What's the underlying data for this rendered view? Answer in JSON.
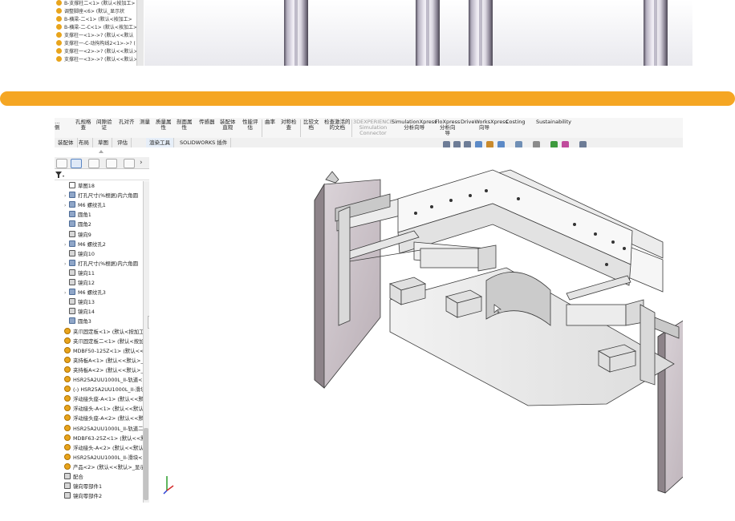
{
  "top_tree": {
    "items": [
      "B-支撑柱二<1> (默认<按加工>",
      "调整脚座<6> (默认_显示状",
      "B-横梁-二<1> (默认<按加工>",
      "B-横梁-二-C<1> (默认<按加工>",
      "支撑柱一<1>->? (默认<<默认",
      "支撑柱一-C-动拘构线2<1>->? (",
      "支撑柱一<2>->? (默认<<默认>",
      "支撑柱一<3>->? (默认<<默认>"
    ]
  },
  "ribbon": {
    "items": [
      {
        "label": "...\n侧"
      },
      {
        "label": "孔规格\n查"
      },
      {
        "label": "间隙验\n证"
      },
      {
        "label": "孔对齐"
      },
      {
        "label": "测量"
      },
      {
        "label": "质量属\n性"
      },
      {
        "label": "剖面属\n性"
      },
      {
        "label": "传感器"
      },
      {
        "label": "装配体\n直观"
      },
      {
        "label": "性能评\n估"
      },
      {
        "label": "曲率"
      },
      {
        "label": "对称检\n查"
      },
      {
        "label": "比较文\n档"
      },
      {
        "label": "检查激活的\n的文档"
      },
      {
        "label": "3DEXPERIENCE\nSimulation\nConnector"
      },
      {
        "label": "SimulationXpress\n分析向导"
      },
      {
        "label": "FloXpress\n分析向\n导"
      },
      {
        "label": "DriveWorksXpress\n向导"
      },
      {
        "label": "Costing"
      },
      {
        "label": "Sustainability"
      }
    ]
  },
  "tabs": [
    "装配体",
    "布局",
    "草图",
    "评估",
    "渲染工具",
    "SOLIDWORKS 插件"
  ],
  "feature_tree": {
    "items": [
      {
        "label": "草图18",
        "icon": "sketch-icon",
        "indent": 1,
        "expand": false
      },
      {
        "label": "打孔尺寸(%根据)内六角圆",
        "icon": "hole-wizard-icon",
        "indent": 1,
        "expand": true
      },
      {
        "label": "M6 螺纹孔1",
        "icon": "hole-wizard-icon",
        "indent": 1,
        "expand": true
      },
      {
        "label": "圆角1",
        "icon": "fillet-icon",
        "indent": 1,
        "expand": false
      },
      {
        "label": "圆角2",
        "icon": "fillet-icon",
        "indent": 1,
        "expand": false
      },
      {
        "label": "镜向9",
        "icon": "mirror-icon",
        "indent": 1,
        "expand": false
      },
      {
        "label": "M6 螺纹孔2",
        "icon": "hole-wizard-icon",
        "indent": 1,
        "expand": true
      },
      {
        "label": "镜向10",
        "icon": "mirror-icon",
        "indent": 1,
        "expand": false
      },
      {
        "label": "打孔尺寸(%根据)内六角圆",
        "icon": "hole-wizard-icon",
        "indent": 1,
        "expand": true
      },
      {
        "label": "镜向11",
        "icon": "mirror-icon",
        "indent": 1,
        "expand": false
      },
      {
        "label": "镜向12",
        "icon": "mirror-icon",
        "indent": 1,
        "expand": false
      },
      {
        "label": "M6 螺纹孔3",
        "icon": "hole-wizard-icon",
        "indent": 1,
        "expand": true
      },
      {
        "label": "镜向13",
        "icon": "mirror-icon",
        "indent": 1,
        "expand": false
      },
      {
        "label": "镜向14",
        "icon": "mirror-icon",
        "indent": 1,
        "expand": false
      },
      {
        "label": "圆角3",
        "icon": "fillet-icon",
        "indent": 1,
        "expand": false
      },
      {
        "label": "夹爪固定板<1> (默认<按加工",
        "icon": "part-icon",
        "indent": 0,
        "expand": false
      },
      {
        "label": "夹爪固定板二<1> (默认<按加",
        "icon": "part-icon",
        "indent": 0,
        "expand": false
      },
      {
        "label": "MDBF50-125Z<1> (默认<<默",
        "icon": "part-icon",
        "indent": 0,
        "expand": false
      },
      {
        "label": "夹持板A<1> (默认<<默认>_",
        "icon": "part-icon",
        "indent": 0,
        "expand": false
      },
      {
        "label": "夹持板A<2> (默认<<默认>_",
        "icon": "part-icon",
        "indent": 0,
        "expand": false
      },
      {
        "label": "HSR25A2UU1000L_II-轨道<1",
        "icon": "part-icon",
        "indent": 0,
        "expand": false
      },
      {
        "label": "(-) HSR25A2UU1000L_II-滑块",
        "icon": "part-icon",
        "indent": 0,
        "expand": false
      },
      {
        "label": "浮动接头座-A<1> (默认<<默",
        "icon": "part-icon",
        "indent": 0,
        "expand": false
      },
      {
        "label": "浮动接头-A<1> (默认<<默认",
        "icon": "part-icon",
        "indent": 0,
        "expand": false
      },
      {
        "label": "浮动接头座-A<2> (默认<<默",
        "icon": "part-icon",
        "indent": 0,
        "expand": false
      },
      {
        "label": "HSR25A2UU1000L_II-轨道二",
        "icon": "part-icon",
        "indent": 0,
        "expand": false
      },
      {
        "label": "MDBF63-25Z<1> (默认<<默",
        "icon": "part-icon",
        "indent": 0,
        "expand": false
      },
      {
        "label": "浮动接头-A<2> (默认<<默认",
        "icon": "part-icon",
        "indent": 0,
        "expand": false
      },
      {
        "label": "HSR25A2UU1000L_II-滑块<2",
        "icon": "part-icon",
        "indent": 0,
        "expand": false
      },
      {
        "label": "产品<2> (默认<<默认>_显示",
        "icon": "assembly-icon",
        "indent": 0,
        "expand": false
      },
      {
        "label": "配合",
        "icon": "mates-icon",
        "indent": 0,
        "expand": false
      },
      {
        "label": "镜向零部件1",
        "icon": "mirror-component-icon",
        "indent": 0,
        "expand": false
      },
      {
        "label": "镜向零部件2",
        "icon": "mirror-component-icon",
        "indent": 0,
        "expand": false
      }
    ]
  },
  "colors": {
    "divider": "#f5a623",
    "part_icon": "#e8a41c",
    "model_plate": "#cfc6cc",
    "model_edge": "#3a3a3a"
  }
}
